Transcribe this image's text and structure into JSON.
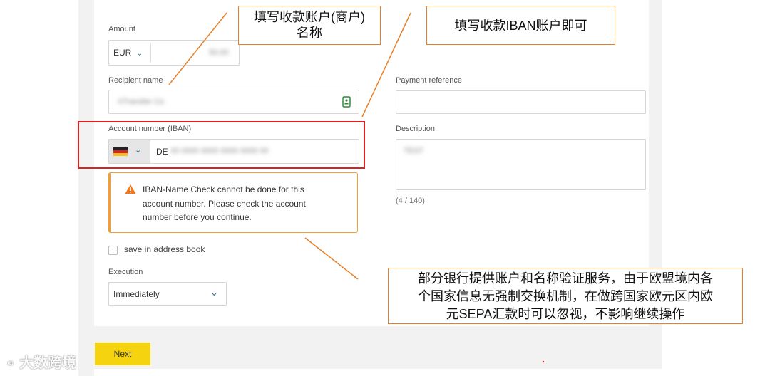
{
  "form": {
    "amount_label": "Amount",
    "currency": "EUR",
    "amount_value": "50.00",
    "recipient_label": "Recipient name",
    "recipient_value": "XTransfer Co",
    "iban_label": "Account number (IBAN)",
    "iban_prefix": "DE",
    "iban_value": "00 0000 0000 0000 0000 00",
    "reference_label": "Payment reference",
    "description_label": "Description",
    "description_value": "TEST",
    "description_count": "(4 / 140)",
    "warning_text": "IBAN-Name Check cannot be done for this account number. Please check the account number before you continue.",
    "save_label": "save in address book",
    "execution_label": "Execution",
    "execution_value": "Immediately",
    "next_label": "Next"
  },
  "annotations": {
    "recipient_note_line1": "填写收款账户(商户)",
    "recipient_note_line2": "名称",
    "iban_note": "填写收款IBAN账户即可",
    "warning_note_line1": "部分银行提供账户和名称验证服务，由于欧盟境内各",
    "warning_note_line2": "个国家信息无强制交换机制，在做跨国家欧元区内欧",
    "warning_note_line3": "元SEPA汇款时可以忽视，不影响继续操作"
  },
  "watermark": "大数跨境",
  "colors": {
    "accent": "#f5d40f",
    "callout_border": "#e5802a",
    "highlight": "#e02020",
    "warning": "#f0a030"
  }
}
